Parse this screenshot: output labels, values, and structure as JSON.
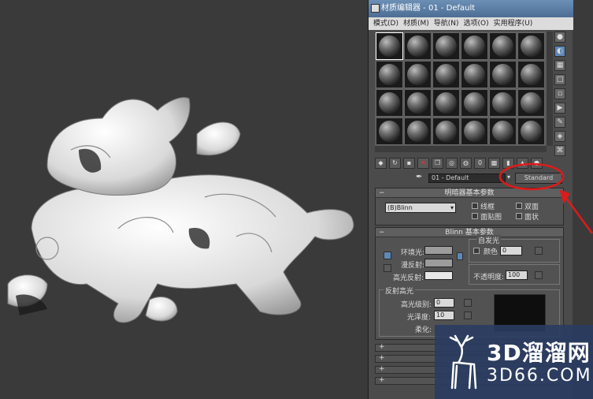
{
  "window": {
    "title": "材质编辑器 - 01 - Default",
    "menu": [
      "模式(D)",
      "材质(M)",
      "导航(N)",
      "选项(O)",
      "实用程序(U)"
    ]
  },
  "material": {
    "name": "01 - Default",
    "type_button": "Standard"
  },
  "shader_basic": {
    "header": "明暗器基本参数",
    "shader": "(B)Blinn",
    "options": [
      "线框",
      "双面",
      "面贴图",
      "面状"
    ]
  },
  "blinn_basic": {
    "header": "Blinn 基本参数",
    "self_illum_label": "自发光",
    "color_label": "颜色",
    "color_value": "0",
    "ambient": "环境光:",
    "diffuse": "漫反射:",
    "specular": "高光反射:",
    "opacity_label": "不透明度:",
    "opacity_value": "100",
    "spec_hl_label": "反射高光",
    "spec_level_label": "高光级别:",
    "spec_level_value": "0",
    "glossiness_label": "光泽度:",
    "glossiness_value": "10",
    "soften_label": "柔化:"
  },
  "watermark": {
    "line1": "3D溜溜网",
    "line2": "3D66.COM"
  },
  "colors": {
    "accent_red": "#e01a1a",
    "titlebar": "#5f82aa",
    "watermark_bg": "#2a3c63"
  }
}
